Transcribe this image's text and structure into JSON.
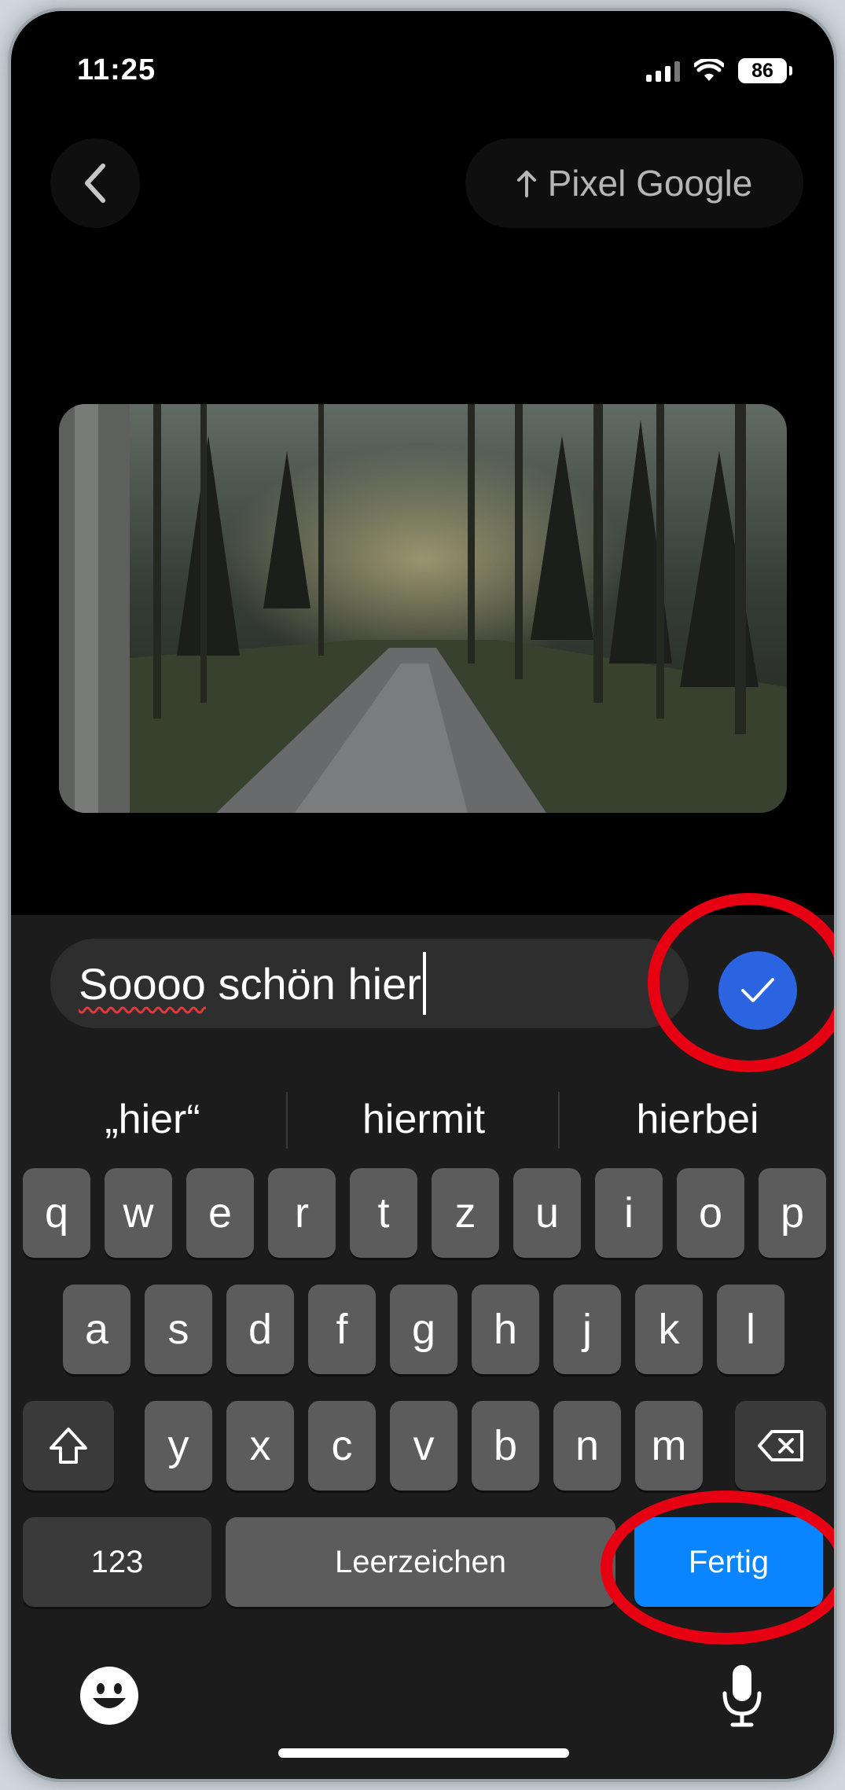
{
  "status": {
    "time": "11:25",
    "battery": "86"
  },
  "nav": {
    "share_label": "Pixel Google"
  },
  "input": {
    "word1": "Soooo",
    "rest": " schön hier"
  },
  "suggestions": [
    "„hier“",
    "hiermit",
    "hierbei"
  ],
  "keyboard": {
    "row1": [
      "q",
      "w",
      "e",
      "r",
      "t",
      "z",
      "u",
      "i",
      "o",
      "p"
    ],
    "row2": [
      "a",
      "s",
      "d",
      "f",
      "g",
      "h",
      "j",
      "k",
      "l"
    ],
    "row3": [
      "y",
      "x",
      "c",
      "v",
      "b",
      "n",
      "m"
    ],
    "numbers": "123",
    "space": "Leerzeichen",
    "done": "Fertig"
  },
  "colors": {
    "accent_blue": "#0a84ff",
    "confirm_blue": "#2a64e0",
    "highlight_red": "#e60012"
  }
}
